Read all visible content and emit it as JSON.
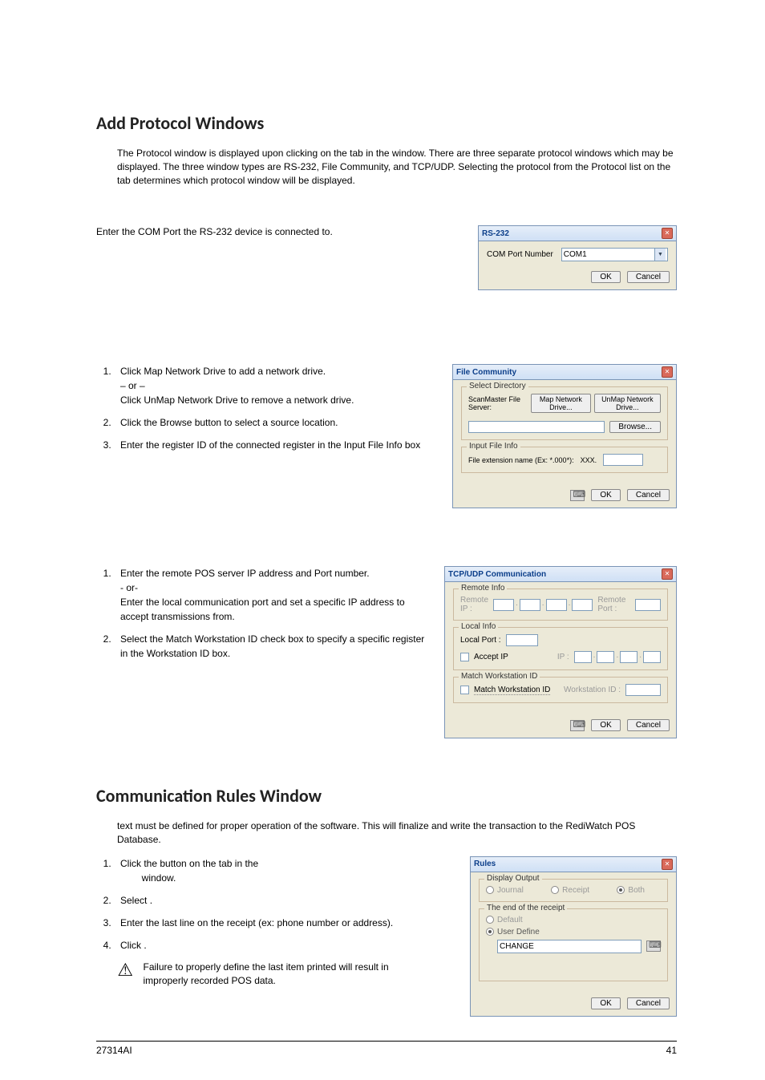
{
  "section1": {
    "title": "Add Protocol Windows",
    "intro_parts": [
      "The Protocol window is displayed upon clicking ",
      " on the ",
      " tab in the ",
      " window. There are three separate protocol windows which may be displayed. The three window types are RS-232, File Community, and TCP/UDP.  Selecting the protocol from the Protocol list on the ",
      " tab determines which protocol window will be displayed."
    ],
    "rs232": {
      "desc": "Enter the COM Port the RS-232 device is connected to.",
      "dialog_title": "RS-232",
      "label": "COM Port Number",
      "value": "COM1",
      "ok": "OK",
      "cancel": "Cancel"
    },
    "filecomm": {
      "steps": [
        "Click Map Network Drive to add a network drive.\n – or –\nClick UnMap Network Drive to remove a network drive.",
        "Click the Browse button to select a source location.",
        "Enter the register ID of the connected register in the Input File Info box"
      ],
      "dialog_title": "File Community",
      "select_dir": "Select Directory",
      "sms_label": "ScanMaster File Server:",
      "map_btn": "Map Network Drive...",
      "unmap_btn": "UnMap Network Drive...",
      "browse_btn": "Browse...",
      "input_file": "Input File Info",
      "ext_label": "File extension name (Ex: *.000*):",
      "ext_value": "XXX.",
      "ok": "OK",
      "cancel": "Cancel"
    },
    "tcp": {
      "steps": [
        "Enter the remote POS server IP address and Port number.\n- or-\nEnter the local communication port and set a specific IP address to accept transmissions from.",
        "Select the Match Workstation ID check box to specify a specific register in the Workstation ID box."
      ],
      "dialog_title": "TCP/UDP Communication",
      "remote_info": "Remote Info",
      "remote_ip": "Remote IP :",
      "remote_port": "Remote Port :",
      "local_info": "Local Info",
      "local_port": "Local Port :",
      "accept_ip": "Accept IP",
      "ip_label": "IP :",
      "mwid_legend": "Match Workstation ID",
      "mwid_cb": "Match Workstation ID",
      "wid_label": "Workstation ID :",
      "ok": "OK",
      "cancel": "Cancel"
    }
  },
  "section2": {
    "title": "Communication Rules Window",
    "intro": " text must be defined for proper operation of the software. This will finalize and write the transaction to the RediWatch POS Database.",
    "steps": {
      "s1a": "Click the ",
      "s1b": " button on the ",
      "s1c": " tab in the ",
      "s1d": " window.",
      "s2a": "Select ",
      "s2b": ".",
      "s3": "Enter the last line on the receipt (ex: phone number or address).",
      "s4a": "Click ",
      "s4b": "."
    },
    "warning": "Failure to properly define the last item printed will result in improperly recorded POS data.",
    "rules": {
      "dialog_title": "Rules",
      "display_output": "Display Output",
      "journal": "Journal",
      "receipt": "Receipt",
      "both": "Both",
      "end_legend": "The end of the receipt",
      "default": "Default",
      "user_define": "User Define",
      "user_value": "CHANGE",
      "ok": "OK",
      "cancel": "Cancel"
    }
  },
  "footer": {
    "left": "27314AI",
    "right": "41"
  }
}
